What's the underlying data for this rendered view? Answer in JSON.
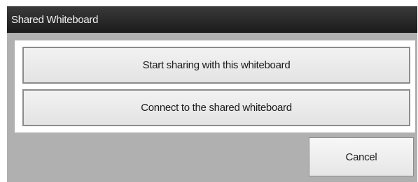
{
  "window": {
    "title": "Shared Whiteboard"
  },
  "options": [
    {
      "label": "Start sharing with this whiteboard"
    },
    {
      "label": "Connect to the shared whiteboard"
    }
  ],
  "footer": {
    "cancel_label": "Cancel"
  },
  "colors": {
    "titlebar": "#2a2a2a",
    "dialog_background": "#b0b0b0",
    "panel_background": "#ffffff",
    "button_face": "#ececec",
    "button_border": "#8c8c8c"
  }
}
